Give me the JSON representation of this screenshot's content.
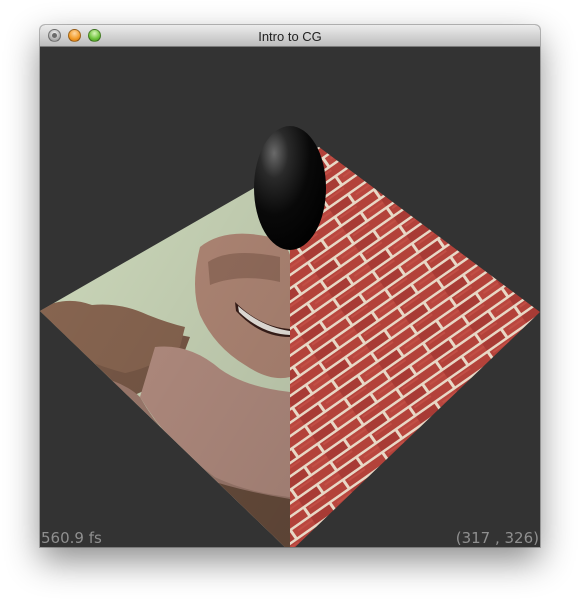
{
  "window": {
    "title": "Intro to CG"
  },
  "viewport": {
    "background_color": "#333333",
    "fps_text": "560.9 fs",
    "coordinate_text": "(317 , 326)"
  },
  "scene": {
    "left_texture": "face-photo",
    "right_texture": "red-brick-wall",
    "brick_color": "#b3423a",
    "mortar_color": "#e9d9c8",
    "sphere_color": "#000000"
  }
}
